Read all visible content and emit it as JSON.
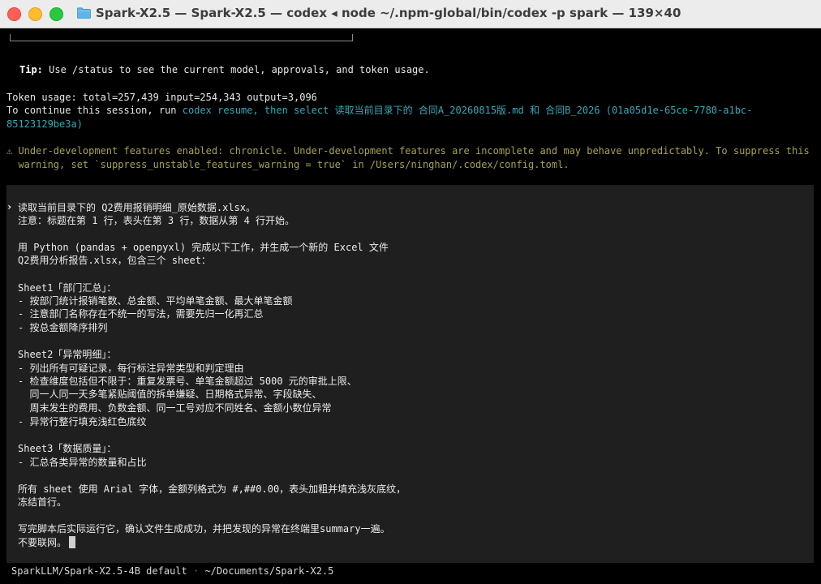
{
  "window": {
    "title": "Spark-X2.5 — Spark-X2.5 — codex ◂ node ~/.npm-global/bin/codex -p spark — 139×40"
  },
  "terminal": {
    "tip_label": "Tip:",
    "tip_text": " Use /status to see the current model, approvals, and token usage.",
    "token_usage": "Token usage: total=257,439 input=254,343 output=3,096",
    "continue_prefix": "To continue this session, run ",
    "continue_cmd_1": "codex resume, then select 读取当前目录下的 合同A_20260815版.md 和 合同B_2026 (01a05d1e-65ce-7780-a1bc-",
    "continue_cmd_2": "85123129be3a)",
    "warning_1": "⚠ Under-development features enabled: chronicle. Under-development features are incomplete and may behave unpredictably. To suppress this",
    "warning_2": "  warning, set `suppress_unstable_features_warning = true` in /Users/ninghan/.codex/config.toml."
  },
  "prompt": {
    "chevron": "›",
    "lines": [
      "读取当前目录下的 Q2费用报销明细_原始数据.xlsx。",
      "注意：标题在第 1 行，表头在第 3 行，数据从第 4 行开始。",
      "",
      "用 Python (pandas + openpyxl) 完成以下工作，并生成一个新的 Excel 文件",
      "Q2费用分析报告.xlsx，包含三个 sheet：",
      "",
      "Sheet1「部门汇总」：",
      "- 按部门统计报销笔数、总金额、平均单笔金额、最大单笔金额",
      "- 注意部门名称存在不统一的写法，需要先归一化再汇总",
      "- 按总金额降序排列",
      "",
      "Sheet2「异常明细」：",
      "- 列出所有可疑记录，每行标注异常类型和判定理由",
      "- 检查维度包括但不限于：重复发票号、单笔金额超过 5000 元的审批上限、",
      "  同一人同一天多笔紧贴阈值的拆单嫌疑、日期格式异常、字段缺失、",
      "  周末发生的费用、负数金额、同一工号对应不同姓名、金额小数位异常",
      "- 异常行整行填充浅红色底纹",
      "",
      "Sheet3「数据质量」：",
      "- 汇总各类异常的数量和占比",
      "",
      "所有 sheet 使用 Arial 字体，金额列格式为 #,##0.00，表头加粗并填充浅灰底纹，",
      "冻结首行。",
      "",
      "写完脚本后实际运行它，确认文件生成成功，并把发现的异常在终端里summary一遍。",
      "不要联网。"
    ]
  },
  "footer": {
    "model": "SparkLLM/Spark-X2.5-4B default",
    "separator": " · ",
    "path": "~/Documents/Spark-X2.5"
  },
  "colors": {
    "accent_cyan": "#3aa7b8",
    "warning_yellow": "#a9a24f",
    "close": "#ff5f57",
    "minimize": "#febc2e",
    "maximize": "#28c840"
  },
  "icons": {
    "title_icon": "folder-icon",
    "prompt_icon": "chevron-right-icon"
  }
}
